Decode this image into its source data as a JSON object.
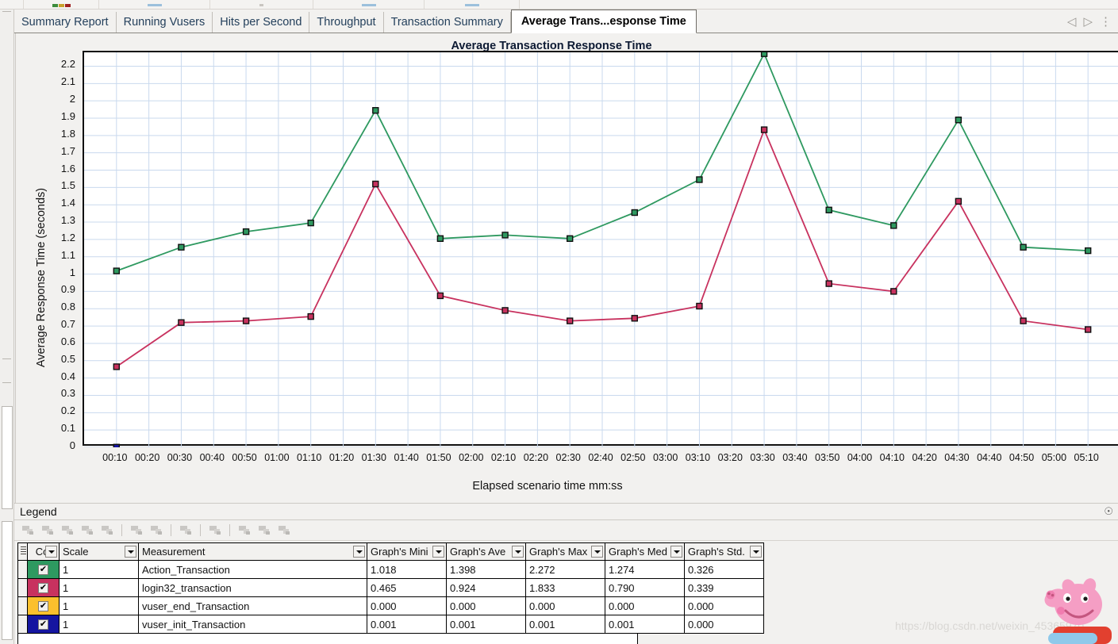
{
  "window": {
    "tabs": [
      {
        "label": "Summary Report",
        "active": false
      },
      {
        "label": "Running Vusers",
        "active": false
      },
      {
        "label": "Hits per Second",
        "active": false
      },
      {
        "label": "Throughput",
        "active": false
      },
      {
        "label": "Transaction Summary",
        "active": false
      },
      {
        "label": "Average Trans...esponse Time",
        "active": true
      }
    ],
    "tab_nav": {
      "prev": "◁",
      "next": "▷",
      "menu": "⋮"
    }
  },
  "chart_data": {
    "type": "line",
    "title": "Average Transaction Response Time",
    "xlabel": "Elapsed scenario time mm:ss",
    "ylabel": "Average Response Time (seconds)",
    "grid": true,
    "legend_position": "bottom-table",
    "ylim": [
      0,
      2.28
    ],
    "yticks": [
      "0",
      "0.1",
      "0.2",
      "0.3",
      "0.4",
      "0.5",
      "0.6",
      "0.7",
      "0.8",
      "0.9",
      "1",
      "1.1",
      "1.2",
      "1.3",
      "1.4",
      "1.5",
      "1.6",
      "1.7",
      "1.8",
      "1.9",
      "2",
      "2.1",
      "2.2"
    ],
    "ytick_values": [
      0,
      0.1,
      0.2,
      0.3,
      0.4,
      0.5,
      0.6,
      0.7,
      0.8,
      0.9,
      1,
      1.1,
      1.2,
      1.3,
      1.4,
      1.5,
      1.6,
      1.7,
      1.8,
      1.9,
      2,
      2.1,
      2.2
    ],
    "categories": [
      "00:10",
      "00:20",
      "00:30",
      "00:40",
      "00:50",
      "01:00",
      "01:10",
      "01:20",
      "01:30",
      "01:40",
      "01:50",
      "02:00",
      "02:10",
      "02:20",
      "02:30",
      "02:40",
      "02:50",
      "03:00",
      "03:10",
      "03:20",
      "03:30",
      "03:40",
      "03:50",
      "04:00",
      "04:10",
      "04:20",
      "04:30",
      "04:40",
      "04:50",
      "05:00",
      "05:10"
    ],
    "series": [
      {
        "name": "Action_Transaction",
        "color": "#2E9960",
        "x": [
          "00:10",
          "00:30",
          "00:50",
          "01:10",
          "01:30",
          "01:50",
          "02:10",
          "02:30",
          "02:50",
          "03:10",
          "03:30",
          "03:50",
          "04:10",
          "04:30",
          "04:50",
          "05:10"
        ],
        "values": [
          1.018,
          1.155,
          1.245,
          1.295,
          1.945,
          1.205,
          1.225,
          1.205,
          1.355,
          1.545,
          2.272,
          1.37,
          1.28,
          1.89,
          1.155,
          1.135
        ]
      },
      {
        "name": "login32_transaction",
        "color": "#C8325F",
        "x": [
          "00:10",
          "00:30",
          "00:50",
          "01:10",
          "01:30",
          "01:50",
          "02:10",
          "02:30",
          "02:50",
          "03:10",
          "03:30",
          "03:50",
          "04:10",
          "04:30",
          "04:50",
          "05:10"
        ],
        "values": [
          0.465,
          0.72,
          0.73,
          0.755,
          1.52,
          0.875,
          0.79,
          0.73,
          0.745,
          0.815,
          1.833,
          0.945,
          0.9,
          1.42,
          0.73,
          0.68
        ]
      },
      {
        "name": "vuser_end_Transaction",
        "color": "#FBC02D",
        "x": [
          "00:10"
        ],
        "values": [
          0.0
        ]
      },
      {
        "name": "vuser_init_Transaction",
        "color": "#1515A0",
        "x": [
          "00:10"
        ],
        "values": [
          0.001
        ]
      }
    ]
  },
  "legend_panel": {
    "title": "Legend",
    "pin_icon": "pin-icon",
    "toolbar": [
      {
        "name": "show-all-icon"
      },
      {
        "name": "hide-all-icon"
      },
      {
        "name": "show-only-selected-icon"
      },
      {
        "name": "merge-graphs-icon"
      },
      {
        "name": "filter-icon"
      },
      {
        "sep": true
      },
      {
        "name": "auto-correlate-icon"
      },
      {
        "name": "scale-icon"
      },
      {
        "sep": true
      },
      {
        "name": "set-granularity-icon"
      },
      {
        "sep": true
      },
      {
        "name": "columns-icon"
      },
      {
        "sep": true
      },
      {
        "name": "configure-icon"
      },
      {
        "name": "group-by-icon"
      },
      {
        "name": "properties-icon"
      }
    ],
    "table": {
      "columns": [
        "Col",
        "Scale",
        "Measurement",
        "Graph's Mini",
        "Graph's Ave",
        "Graph's Max",
        "Graph's Med",
        "Graph's Std."
      ],
      "rows": [
        {
          "color": "#2E9960",
          "checked": "✔",
          "scale": "1",
          "measurement": "Action_Transaction",
          "min": "1.018",
          "avg": "1.398",
          "max": "2.272",
          "median": "1.274",
          "std": "0.326"
        },
        {
          "color": "#C8325F",
          "checked": "✔",
          "scale": "1",
          "measurement": "login32_transaction",
          "min": "0.465",
          "avg": "0.924",
          "max": "1.833",
          "median": "0.790",
          "std": "0.339"
        },
        {
          "color": "#FBC02D",
          "checked": "✔",
          "scale": "1",
          "measurement": "vuser_end_Transaction",
          "min": "0.000",
          "avg": "0.000",
          "max": "0.000",
          "median": "0.000",
          "std": "0.000"
        },
        {
          "color": "#1515A0",
          "checked": "✔",
          "scale": "1",
          "measurement": "vuser_init_Transaction",
          "min": "0.001",
          "avg": "0.001",
          "max": "0.001",
          "median": "0.001",
          "std": "0.000"
        }
      ]
    }
  },
  "watermark": {
    "text": "https://blog.csdn.net/weixin_45365970"
  }
}
